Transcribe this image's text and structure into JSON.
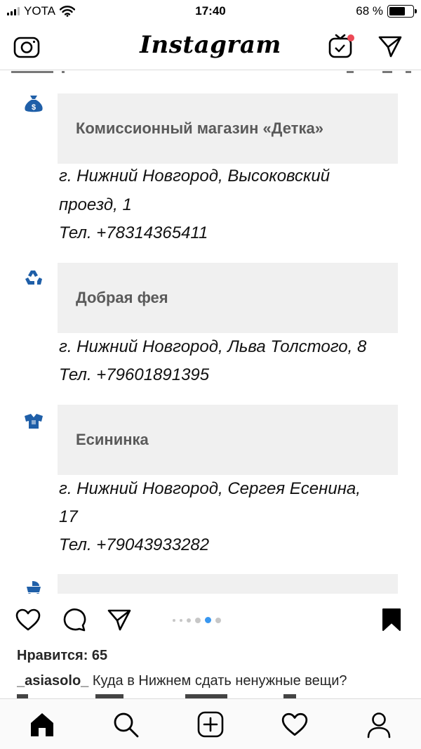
{
  "status_bar": {
    "carrier": "YOTA",
    "time": "17:40",
    "battery_text": "68 %",
    "battery_level": 0.68
  },
  "top_nav": {
    "logo": "Instagram",
    "left_icon": "camera-icon",
    "right_icons": [
      "igtv-icon",
      "direct-message-icon"
    ],
    "notification_color": "#ed4956"
  },
  "post": {
    "entries": [
      {
        "icon": "money-bag-icon",
        "title": "Комиссионный магазин «Детка»",
        "lines": [
          "г. Нижний Новгород, Высоковский",
          "проезд, 1",
          "Тел. +78314365411"
        ]
      },
      {
        "icon": "recycle-icon",
        "title": "Добрая фея",
        "lines": [
          "г. Нижний Новгород, Льва Толстого, 8",
          "Тел. +79601891395"
        ]
      },
      {
        "icon": "baby-clothes-icon",
        "title": "Есининка",
        "lines": [
          "г. Нижний Новгород, Сергея Есенина,",
          "17",
          "Тел. +79043933282"
        ]
      },
      {
        "icon": "stroller-icon",
        "title": "",
        "lines": []
      }
    ],
    "icon_color": "#1f5fa8",
    "carousel": {
      "count": 6,
      "active_index": 4,
      "active_color": "#3897f0"
    },
    "likes_text": "Нравится: 65",
    "caption_user": "_asiasolo_",
    "caption_text": "Куда в Нижнем сдать ненужные вещи?"
  },
  "tab_bar": {
    "items": [
      "home-icon",
      "search-icon",
      "new-post-icon",
      "activity-icon",
      "profile-icon"
    ]
  }
}
